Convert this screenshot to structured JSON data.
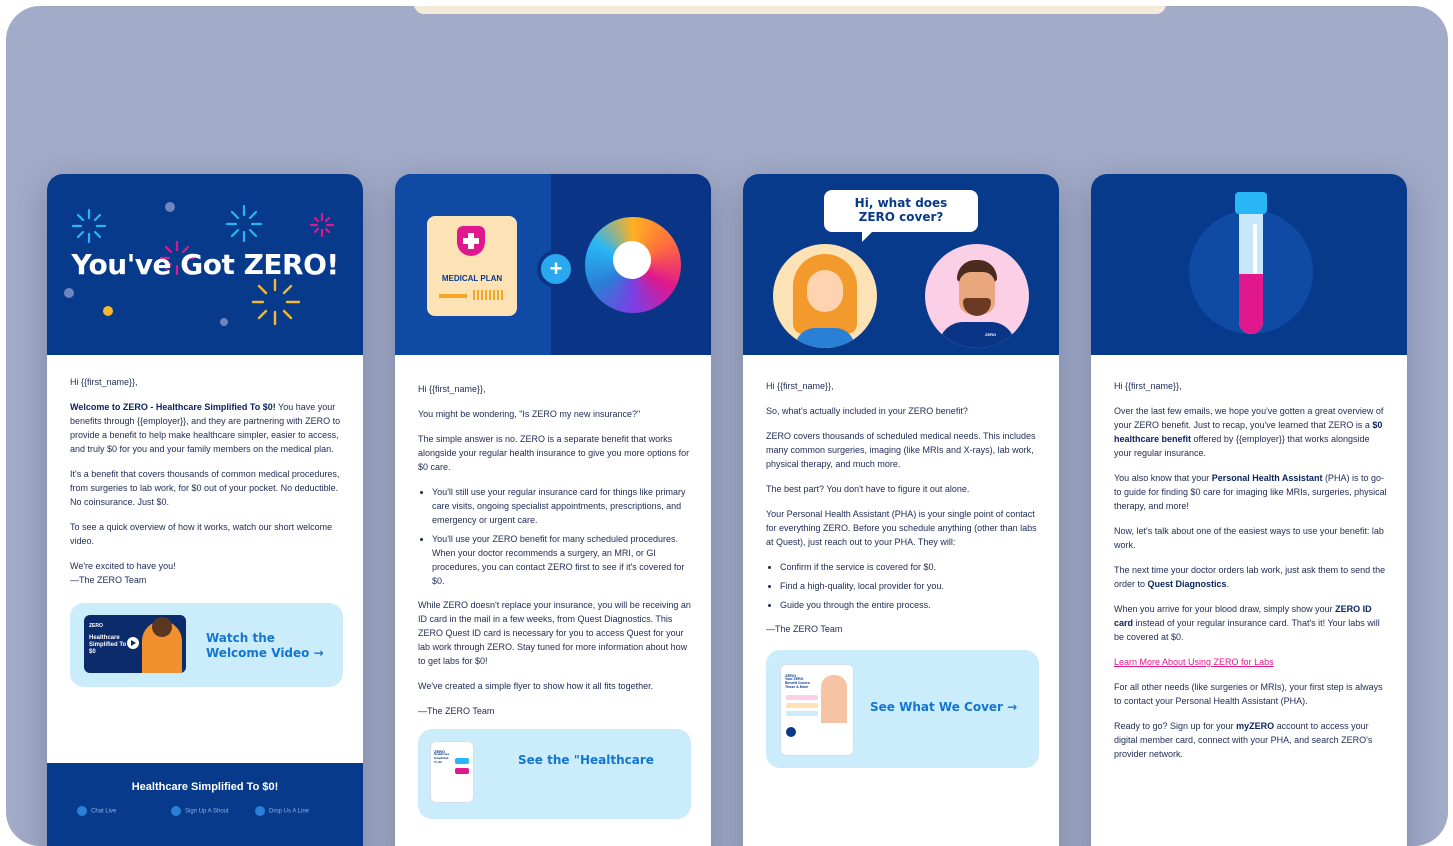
{
  "colors": {
    "navy": "#083a8c",
    "accent_pink": "#e0178d",
    "cta_bg": "#cbecfb",
    "cta_text": "#1276d3",
    "backdrop": "#a2abc7"
  },
  "card1": {
    "hero_title": "You've Got ZERO!",
    "greeting": "Hi {{first_name}},",
    "p1_bold": "Welcome to ZERO - Healthcare Simplified To $0!",
    "p1_rest": " You have your benefits through {{employer}}, and they are partnering with ZERO to provide a benefit to help make healthcare simpler, easier to access, and truly $0 for you and your family members on the medical plan.",
    "p2": "It's a benefit that covers thousands of common medical procedures, from surgeries to lab work, for $0 out of your pocket. No deductible. No coinsurance. Just $0.",
    "p3": "To see a quick overview of how it works, watch our short welcome video.",
    "sign1": "We're excited to have you!",
    "sign2": "—The ZERO Team",
    "cta_label": "Watch the Welcome Video →",
    "thumb_text": "Healthcare Simplified To $0",
    "thumb_logo": "ZERO",
    "footer_title": "Healthcare Simplified To $0!",
    "footer_links": [
      "Chat Live",
      "Sign Up A Shout",
      "Drop Us A Line"
    ]
  },
  "card2": {
    "plan_label": "MEDICAL PLAN",
    "greeting": "Hi {{first_name}},",
    "p1": "You might be wondering, \"Is ZERO my new insurance?\"",
    "p2": "The simple answer is no. ZERO is a separate benefit that works alongside your regular health insurance to give you more options for $0 care.",
    "bullets": [
      "You'll still use your regular insurance card for things like primary care visits, ongoing specialist appointments, prescriptions, and emergency or urgent care.",
      "You'll use your ZERO benefit for many scheduled procedures. When your doctor recommends a surgery, an MRI, or GI procedures, you can contact ZERO first to see if it's covered for $0."
    ],
    "p3": "While ZERO doesn't replace your insurance, you will be receiving an ID card in the mail in a few weeks, from Quest Diagnostics. This ZERO Quest ID card is necessary for you to access Quest for your lab work through ZERO. Stay tuned for more information about how to get labs for $0!",
    "p4": "We've created a simple flyer to show how it all fits together.",
    "sign": "—The ZERO Team",
    "cta_label": "See the \"Healthcare",
    "thumb_title": "Healthcare Simplified To $0",
    "thumb_logo": "ZERO"
  },
  "card3": {
    "bubble": "Hi, what does ZERO cover?",
    "badge": "ZERO",
    "greeting": "Hi {{first_name}},",
    "p1": "So, what's actually included in your ZERO benefit?",
    "p2": "ZERO covers thousands of scheduled medical needs. This includes many common surgeries, imaging (like MRIs and X-rays), lab work, physical therapy, and much more.",
    "p3": "The best part? You don't have to figure it out alone.",
    "p4": "Your Personal Health Assistant (PHA) is your single point of contact for everything ZERO. Before you schedule anything (other than labs at Quest), just reach out to your PHA. They will:",
    "bullets": [
      "Confirm if the service is covered for $0.",
      "Find a high-quality, local provider for you.",
      "Guide you through the entire process."
    ],
    "sign": "—The ZERO Team",
    "cta_label": "See What We Cover →",
    "thumb_title": "Your ZERO Benefit Covers Those & More",
    "thumb_logo": "ZERO"
  },
  "card4": {
    "greeting": "Hi {{first_name}},",
    "p1a": "Over the last few emails, we hope you've gotten a great overview of your ZERO benefit. Just to recap, you've learned that ZERO is a ",
    "p1b": "$0 healthcare benefit",
    "p1c": " offered by {{employer}} that works alongside your regular insurance.",
    "p2a": "You also know that your ",
    "p2b": "Personal Health Assistant",
    "p2c": " (PHA) is to go-to guide for finding $0 care for imaging like MRIs, surgeries, physical therapy, and more!",
    "p3": "Now, let's talk about one of the easiest ways to use your benefit: lab work.",
    "p4a": "The next time your doctor orders lab work, just ask them to send the order to ",
    "p4b": "Quest Diagnostics",
    "p4c": ".",
    "p5a": "When you arrive for your blood draw, simply show your ",
    "p5b": "ZERO ID card",
    "p5c": " instead of your regular insurance card. That's it! Your labs will be covered at $0.",
    "link": "Learn More About Using ZERO for Labs",
    "p6": "For all other needs (like surgeries or MRIs), your first step is always to contact your Personal Health Assistant (PHA).",
    "p7a": "Ready to go? Sign up for your ",
    "p7b": "myZERO",
    "p7c": " account to access your digital member card, connect with your PHA, and search ZERO's provider network."
  }
}
